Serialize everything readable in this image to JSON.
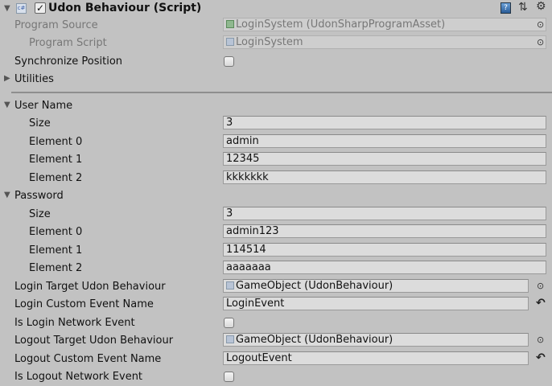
{
  "header": {
    "title": "Udon Behaviour (Script)",
    "enabled": true
  },
  "program_source": {
    "label": "Program Source",
    "value": "LoginSystem (UdonSharpProgramAsset)"
  },
  "program_script": {
    "label": "Program Script",
    "value": "LoginSystem"
  },
  "sync_position": {
    "label": "Synchronize Position",
    "checked": false
  },
  "utilities": {
    "label": "Utilities"
  },
  "user_name": {
    "label": "User Name",
    "size_label": "Size",
    "size": "3",
    "elements": [
      {
        "label": "Element 0",
        "value": "admin"
      },
      {
        "label": "Element 1",
        "value": "12345"
      },
      {
        "label": "Element 2",
        "value": "kkkkkkk"
      }
    ]
  },
  "password": {
    "label": "Password",
    "size_label": "Size",
    "size": "3",
    "elements": [
      {
        "label": "Element 0",
        "value": "admin123"
      },
      {
        "label": "Element 1",
        "value": "114514"
      },
      {
        "label": "Element 2",
        "value": "aaaaaaa"
      }
    ]
  },
  "login_target": {
    "label": "Login Target Udon Behaviour",
    "value": "GameObject (UdonBehaviour)"
  },
  "login_event": {
    "label": "Login Custom Event Name",
    "value": "LoginEvent"
  },
  "login_network": {
    "label": "Is Login Network Event",
    "checked": false
  },
  "logout_target": {
    "label": "Logout Target Udon Behaviour",
    "value": "GameObject (UdonBehaviour)"
  },
  "logout_event": {
    "label": "Logout Custom Event Name",
    "value": "LogoutEvent"
  },
  "logout_network": {
    "label": "Is Logout Network Event",
    "checked": false
  },
  "icons": {
    "picker": "⊙",
    "revert": "↶"
  }
}
